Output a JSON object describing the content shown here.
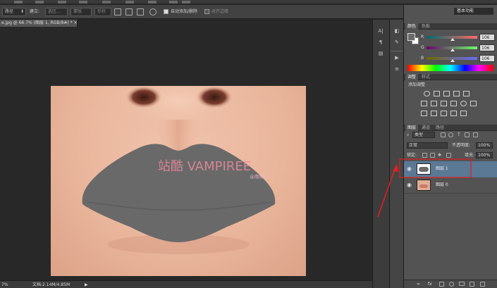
{
  "options_bar": {
    "tool_select": "路径",
    "build_label": "建立:",
    "selection_btn": "选区...",
    "mask_btn": "蒙版",
    "shape_btn": "形状",
    "auto_add_delete": "自动添加/删除",
    "align_edges": "对齐边缘"
  },
  "workspace": {
    "label": "基本功能"
  },
  "document_tab": {
    "title": "e.jpg @ 66.7% (图层 1, RGB/8#) * ×"
  },
  "image": {
    "watermark_title": "站酷 VAMPIREE",
    "watermark_sub": "@雨晴Kc"
  },
  "status_bar": {
    "zoom": "7%",
    "doc_info": "文档:2.14M/4.85M",
    "arrow": "▶"
  },
  "color_panel": {
    "tabs": [
      "颜色",
      "色板"
    ],
    "sliders": [
      {
        "label": "R",
        "value": "106",
        "gradient": "#6a6a6a"
      },
      {
        "label": "G",
        "value": "106",
        "gradient": "#6a6a6a"
      },
      {
        "label": "B",
        "value": "106",
        "gradient": "#6a6a6a"
      }
    ],
    "foreground": "#6a6a6a",
    "background": "#ffffff"
  },
  "adjustments_panel": {
    "tabs": [
      "调整",
      "样式"
    ],
    "heading": "添加调整"
  },
  "layers_panel": {
    "tabs": [
      "图层",
      "通道",
      "路径"
    ],
    "kind_select": "类型",
    "blend_mode": "正常",
    "opacity_label": "不透明度:",
    "opacity_value": "100%",
    "lock_label": "锁定:",
    "fill_label": "填充:",
    "fill_value": "100%",
    "layers": [
      {
        "name": "图层 1",
        "selected": true
      },
      {
        "name": "图层 0",
        "selected": false
      }
    ]
  },
  "colors": {
    "lips_gray": "#696969",
    "annotation_red": "#e02020",
    "selection_blue": "#5b7895",
    "watermark_pink": "#e98a9c"
  }
}
